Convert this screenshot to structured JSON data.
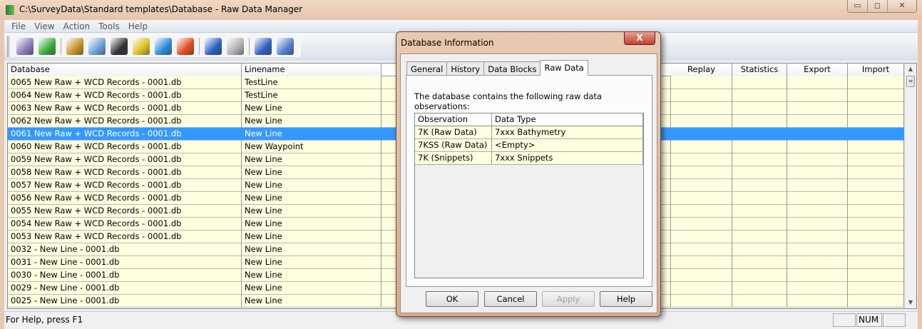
{
  "window": {
    "title": "C:\\SurveyData\\Standard templates\\Database - Raw Data Manager",
    "min": "▭",
    "max": "◻",
    "close": "✕"
  },
  "menu": [
    "File",
    "View",
    "Action",
    "Tools",
    "Help"
  ],
  "toolbar": [
    {
      "icon": "database-edit-icon",
      "color": "#8a7ab8"
    },
    {
      "icon": "database-play-icon",
      "color": "#3caa3c"
    },
    {
      "sep": true
    },
    {
      "icon": "user-icon",
      "color": "#c8902a"
    },
    {
      "icon": "database-search-icon",
      "color": "#6aa0d8"
    },
    {
      "icon": "waterfall-icon",
      "color": "#333333"
    },
    {
      "icon": "fish-icon",
      "color": "#d8c020"
    },
    {
      "icon": "bar-chart-icon",
      "color": "#2a8ad8"
    },
    {
      "icon": "export-icon",
      "color": "#e04a20"
    },
    {
      "sep": true
    },
    {
      "icon": "database-info-icon",
      "color": "#2a60c0"
    },
    {
      "icon": "printer-icon",
      "color": "#b0b0b0"
    },
    {
      "sep": true
    },
    {
      "icon": "checklist-icon",
      "color": "#3060c0"
    },
    {
      "icon": "help-pointer-icon",
      "color": "#5080d0"
    }
  ],
  "grid": {
    "columns": [
      "Database",
      "Linename",
      "Replay",
      "Statistics",
      "Export",
      "Import"
    ],
    "selected_index": 4,
    "rows": [
      [
        "0065 New Raw  + WCD Records - 0001.db",
        "TestLine"
      ],
      [
        "0064 New Raw  + WCD Records - 0001.db",
        "TestLine"
      ],
      [
        "0063 New Raw  + WCD Records - 0001.db",
        "New Line"
      ],
      [
        "0062 New Raw  + WCD Records - 0001.db",
        "New Line"
      ],
      [
        "0061 New Raw  + WCD Records - 0001.db",
        "New Line"
      ],
      [
        "0060 New Raw  + WCD Records - 0001.db",
        "New Waypoint"
      ],
      [
        "0059 New Raw  + WCD Records - 0001.db",
        "New Line"
      ],
      [
        "0058 New Raw  + WCD Records - 0001.db",
        "New Line"
      ],
      [
        "0057 New Raw  + WCD Records - 0001.db",
        "New Line"
      ],
      [
        "0056 New Raw  + WCD Records - 0001.db",
        "New Line"
      ],
      [
        "0055 New Raw  + WCD Records - 0001.db",
        "New Line"
      ],
      [
        "0054 New Raw  + WCD Records - 0001.db",
        "New Line"
      ],
      [
        "0053 New Raw  + WCD Records - 0001.db",
        "New Line"
      ],
      [
        "0032 - New Line - 0001.db",
        "New Line"
      ],
      [
        "0031 - New Line - 0001.db",
        "New Line"
      ],
      [
        "0030 - New Line - 0001.db",
        "New Line"
      ],
      [
        "0029 - New Line - 0001.db",
        "New Line"
      ],
      [
        "0025 - New Line - 0001.db",
        "New Line"
      ]
    ]
  },
  "status": {
    "text": "For Help, press F1",
    "num": "NUM"
  },
  "dialog": {
    "title": "Database Information",
    "close": "X",
    "tabs": [
      "General",
      "History",
      "Data Blocks",
      "Raw Data"
    ],
    "active_tab": 3,
    "description": "The database contains the following raw data observations:",
    "columns": [
      "Observation",
      "Data Type"
    ],
    "rows": [
      [
        "7K (Raw Data)",
        "7xxx Bathymetry"
      ],
      [
        "7KSS (Raw Data)",
        "<Empty>"
      ],
      [
        "7K (Snippets)",
        "7xxx Snippets"
      ]
    ],
    "buttons": {
      "ok": "OK",
      "cancel": "Cancel",
      "apply": "Apply",
      "help": "Help"
    }
  }
}
